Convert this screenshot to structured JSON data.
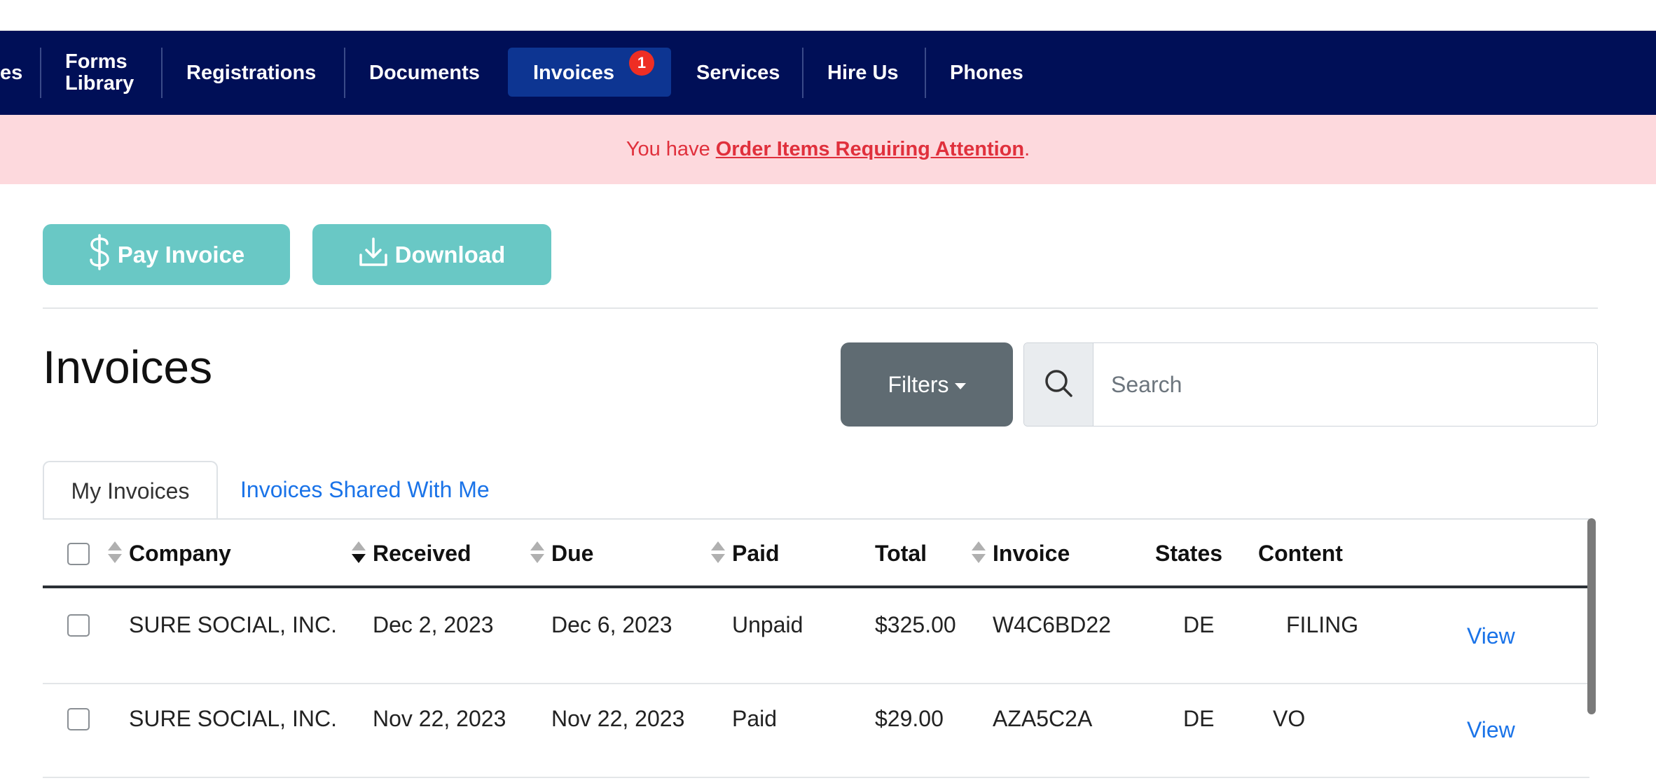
{
  "nav": {
    "items": [
      {
        "label": "es"
      },
      {
        "label_line1": "Forms",
        "label_line2": "Library"
      },
      {
        "label": "Registrations"
      },
      {
        "label": "Documents"
      },
      {
        "label": "Invoices",
        "badge": "1",
        "active": true
      },
      {
        "label": "Services"
      },
      {
        "label": "Hire Us"
      },
      {
        "label": "Phones"
      }
    ]
  },
  "alert": {
    "prefix": "You have",
    "link": "Order Items Requiring Attention",
    "suffix": "."
  },
  "actions": {
    "pay_label": "Pay Invoice",
    "download_label": "Download"
  },
  "page": {
    "title": "Invoices"
  },
  "filters": {
    "label": "Filters"
  },
  "search": {
    "placeholder": "Search"
  },
  "tabs": [
    {
      "label": "My Invoices",
      "active": true
    },
    {
      "label": "Invoices Shared With Me",
      "active": false
    }
  ],
  "table": {
    "headers": {
      "company": "Company",
      "received": "Received",
      "due": "Due",
      "paid": "Paid",
      "total": "Total",
      "invoice": "Invoice",
      "states": "States",
      "content": "Content"
    },
    "rows": [
      {
        "company": "SURE SOCIAL, INC.",
        "received": "Dec 2, 2023",
        "due": "Dec 6, 2023",
        "paid": "Unpaid",
        "total": "$325.00",
        "invoice": "W4C6BD22",
        "states": "DE",
        "content": "FILING",
        "action": "View"
      },
      {
        "company": "SURE SOCIAL, INC.",
        "received": "Nov 22, 2023",
        "due": "Nov 22, 2023",
        "paid": "Paid",
        "total": "$29.00",
        "invoice": "AZA5C2A",
        "states": "DE",
        "content": "VO",
        "action": "View"
      }
    ]
  },
  "colors": {
    "navbar": "#000f57",
    "nav_active": "#0d3592",
    "badge": "#ee2e24",
    "alert_bg": "#fdd9dd",
    "alert_text": "#e0303c",
    "teal_button": "#69c8c5",
    "filters_button": "#5f6b72",
    "link_blue": "#1a73e8"
  }
}
